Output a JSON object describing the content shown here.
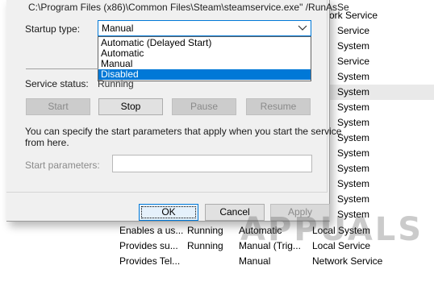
{
  "dialog": {
    "path_text": "C:\\Program Files (x86)\\Common Files\\Steam\\steamservice.exe\" /RunAsSe",
    "startup_type_label": "Startup type:",
    "startup_type_value": "Manual",
    "startup_options": [
      {
        "label": "Automatic (Delayed Start)",
        "selected": false
      },
      {
        "label": "Automatic",
        "selected": false
      },
      {
        "label": "Manual",
        "selected": false
      },
      {
        "label": "Disabled",
        "selected": true
      }
    ],
    "service_status_label": "Service status:",
    "service_status_value": "Running",
    "buttons": {
      "start": "Start",
      "stop": "Stop",
      "pause": "Pause",
      "resume": "Resume"
    },
    "help_text_line1": "You can specify the start parameters that apply when you start the service",
    "help_text_line2": "from here.",
    "start_params_label": "Start parameters:",
    "start_params_value": "",
    "ok": "OK",
    "cancel": "Cancel",
    "apply": "Apply"
  },
  "services_right": [
    "ork Service",
    "Service",
    "System",
    "Service",
    "System",
    "System",
    "System",
    "System",
    "System",
    "System",
    "System",
    "System",
    "System",
    "System"
  ],
  "services_rows": [
    {
      "description": "Enables a us...",
      "status": "Running",
      "startup": "Automatic",
      "logon": "Local System"
    },
    {
      "description": "Provides su...",
      "status": "Running",
      "startup": "Manual (Trig...",
      "logon": "Local Service"
    },
    {
      "description": "Provides Tel...",
      "status": "",
      "startup": "Manual",
      "logon": "Network Service"
    }
  ],
  "watermark": "APPUALS",
  "colors": {
    "accent": "#0078d7",
    "dialog_bg": "#f0f0f0"
  }
}
